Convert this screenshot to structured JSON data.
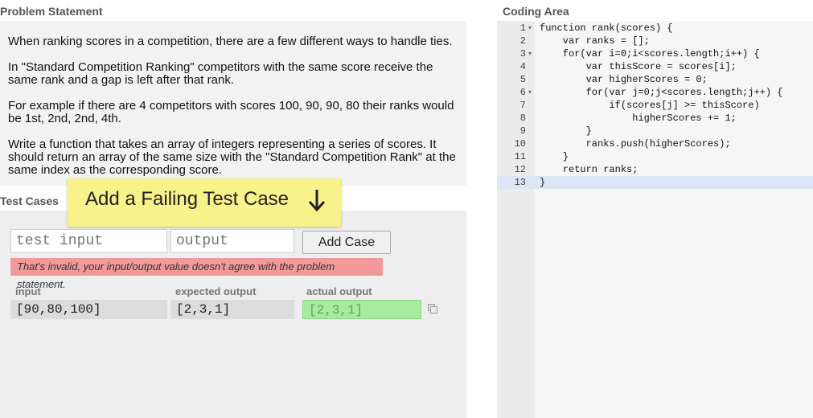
{
  "problem": {
    "title": "Problem Statement",
    "paragraphs": [
      "When ranking scores in a competition, there are a few different ways to handle ties.",
      "In \"Standard Competition Ranking\" competitors with the same score receive the same rank and a gap is left after that rank.",
      "For example if there are 4 competitors with scores 100, 90, 90, 80 their ranks would be 1st, 2nd, 2nd, 4th.",
      "Write a function that takes an array of integers representing a series of scores. It should return an array of the same size with the \"Standard Competition Rank\" at the same index as the corresponding score."
    ]
  },
  "callout": {
    "text": "Add a Failing Test Case",
    "icon": "arrow-down-icon"
  },
  "tests": {
    "title": "Test Cases",
    "input_placeholder": "test input",
    "output_placeholder": "output",
    "add_button": "Add Case",
    "error": "That's invalid, your input/output value doesn't agree with the problem statement.",
    "columns": {
      "input": "input",
      "expected": "expected output",
      "actual": "actual output"
    },
    "rows": [
      {
        "input": "[90,80,100]",
        "expected": "[2,3,1]",
        "actual": "[2,3,1]"
      }
    ],
    "colors": {
      "error_bg": "#f29a9a",
      "pass_bg": "#a8ea9e"
    }
  },
  "editor": {
    "title": "Coding Area",
    "line_numbers": [
      "1",
      "2",
      "3",
      "4",
      "5",
      "6",
      "7",
      "8",
      "9",
      "10",
      "11",
      "12",
      "13"
    ],
    "lines": [
      "function rank(scores) {",
      "    var ranks = [];",
      "    for(var i=0;i<scores.length;i++) {",
      "        var thisScore = scores[i];",
      "        var higherScores = 0;",
      "        for(var j=0;j<scores.length;j++) {",
      "            if(scores[j] >= thisScore)",
      "                higherScores += 1;",
      "        }",
      "        ranks.push(higherScores);",
      "    }",
      "    return ranks;",
      "}"
    ]
  }
}
